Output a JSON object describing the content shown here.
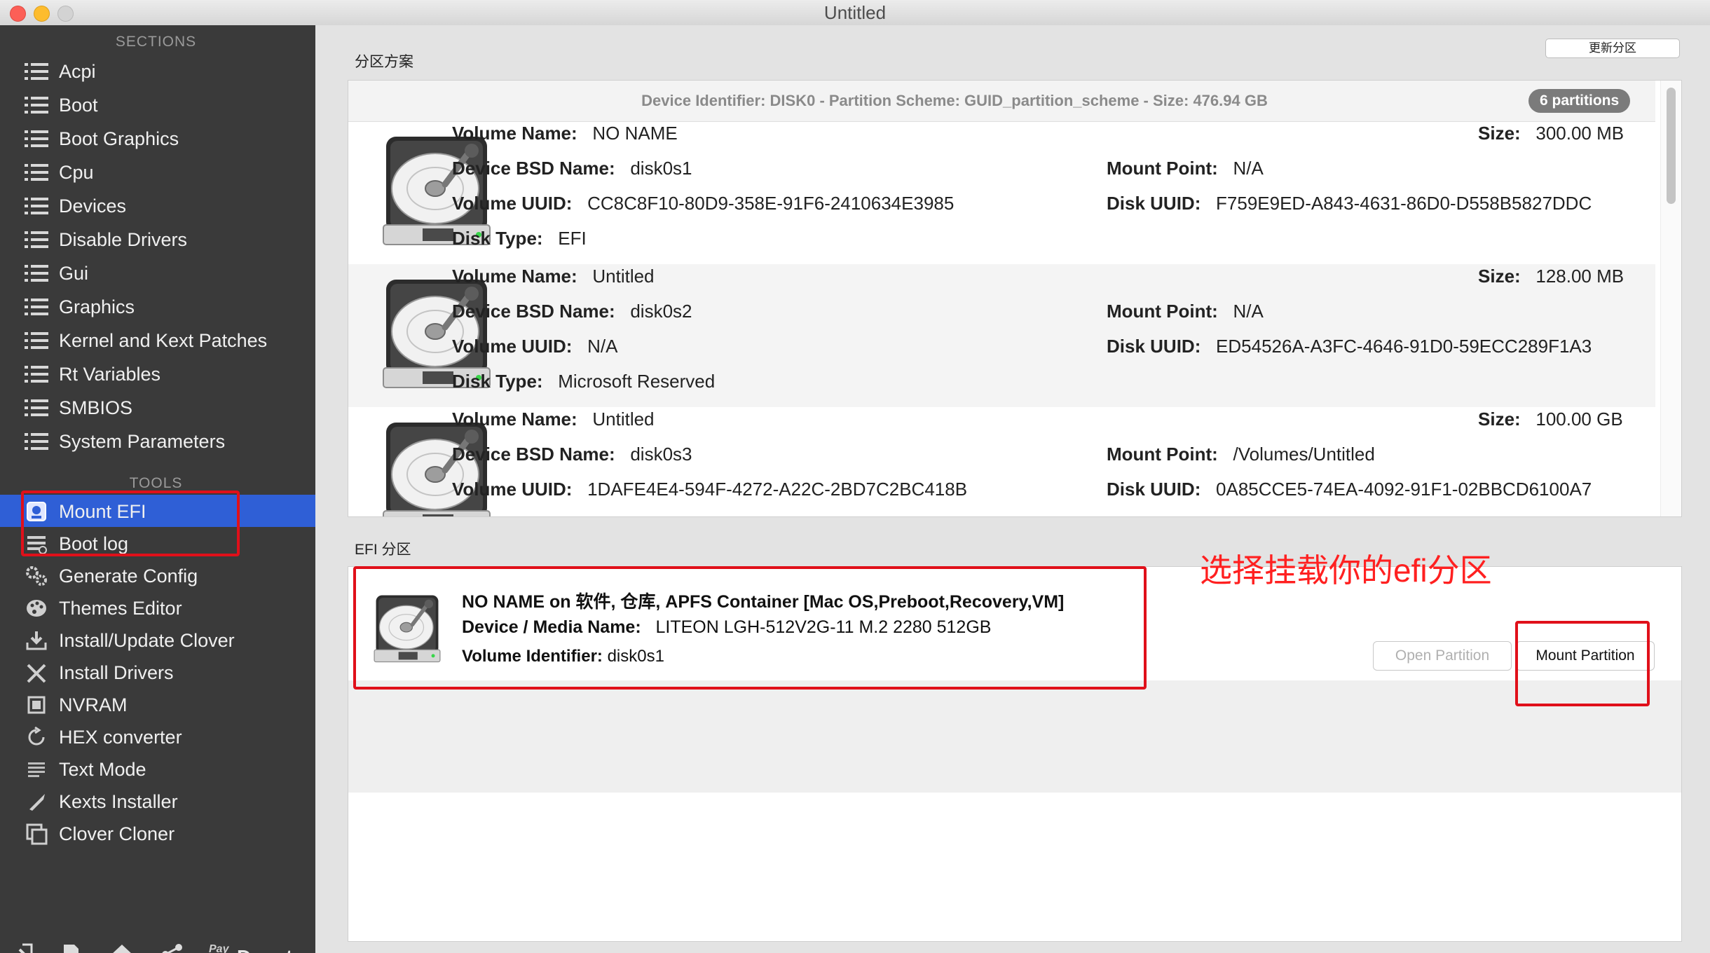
{
  "window": {
    "title": "Untitled"
  },
  "sidebar": {
    "sections_header": "SECTIONS",
    "sections": [
      {
        "label": "Acpi"
      },
      {
        "label": "Boot"
      },
      {
        "label": "Boot Graphics"
      },
      {
        "label": "Cpu"
      },
      {
        "label": "Devices"
      },
      {
        "label": "Disable Drivers"
      },
      {
        "label": "Gui"
      },
      {
        "label": "Graphics"
      },
      {
        "label": "Kernel and Kext Patches"
      },
      {
        "label": "Rt Variables"
      },
      {
        "label": "SMBIOS"
      },
      {
        "label": "System Parameters"
      }
    ],
    "tools_header": "TOOLS",
    "tools": [
      {
        "label": "Mount EFI",
        "icon": "mount-efi-icon",
        "active": true
      },
      {
        "label": "Boot log",
        "icon": "boot-log-icon"
      },
      {
        "label": "Generate Config",
        "icon": "gears-icon"
      },
      {
        "label": "Themes Editor",
        "icon": "palette-icon"
      },
      {
        "label": "Install/Update Clover",
        "icon": "download-icon"
      },
      {
        "label": "Install Drivers",
        "icon": "tools-icon"
      },
      {
        "label": "NVRAM",
        "icon": "chip-icon"
      },
      {
        "label": "HEX converter",
        "icon": "refresh-icon"
      },
      {
        "label": "Text Mode",
        "icon": "text-lines-icon"
      },
      {
        "label": "Kexts Installer",
        "icon": "kext-icon"
      },
      {
        "label": "Clover Cloner",
        "icon": "clone-icon"
      }
    ],
    "bottom": {
      "donate_label": "Donate",
      "paypal_mark": "Pay\nPal"
    }
  },
  "main": {
    "scheme_group_label": "分区方案",
    "refresh_button_label": "更新分区",
    "header": {
      "text": "Device Identifier: DISK0 - Partition Scheme: GUID_partition_scheme - Size: 476.94 GB",
      "partition_count": "6 partitions"
    },
    "labels": {
      "volume_name": "Volume Name:",
      "device_bsd_name": "Device BSD Name:",
      "volume_uuid": "Volume UUID:",
      "disk_type": "Disk Type:",
      "size": "Size:",
      "mount_point": "Mount Point:",
      "disk_uuid": "Disk UUID:"
    },
    "partitions": [
      {
        "volume_name": "NO NAME",
        "bsd": "disk0s1",
        "volume_uuid": "CC8C8F10-80D9-358E-91F6-2410634E3985",
        "disk_type": "EFI",
        "size": "300.00 MB",
        "mount_point": "N/A",
        "disk_uuid": "F759E9ED-A843-4631-86D0-D558B5827DDC"
      },
      {
        "volume_name": "Untitled",
        "bsd": "disk0s2",
        "volume_uuid": "N/A",
        "disk_type": "Microsoft Reserved",
        "size": "128.00 MB",
        "mount_point": "N/A",
        "disk_uuid": "ED54526A-A3FC-4646-91D0-59ECC289F1A3"
      },
      {
        "volume_name": "Untitled",
        "bsd": "disk0s3",
        "volume_uuid": "1DAFE4E4-594F-4272-A22C-2BD7C2BC418B",
        "disk_type": "",
        "size": "100.00 GB",
        "mount_point": "/Volumes/Untitled",
        "disk_uuid": "0A85CCE5-74EA-4092-91F1-02BBCD6100A7"
      }
    ],
    "efi_group_label": "EFI 分区",
    "efi_entry": {
      "title": "NO NAME on 软件, 仓库, APFS Container [Mac OS,Preboot,Recovery,VM]",
      "media_label": "Device / Media Name:",
      "media_value": "LITEON LGH-512V2G-11 M.2 2280 512GB",
      "volume_id_label": "Volume Identifier:",
      "volume_id_value": "disk0s1"
    },
    "open_partition_label": "Open Partition",
    "mount_partition_label": "Mount Partition",
    "annotation": "选择挂载你的efi分区"
  },
  "colors": {
    "sidebar_bg": "#3a3a3a",
    "active": "#2f5fd6",
    "annotation_red": "#e0101a"
  }
}
